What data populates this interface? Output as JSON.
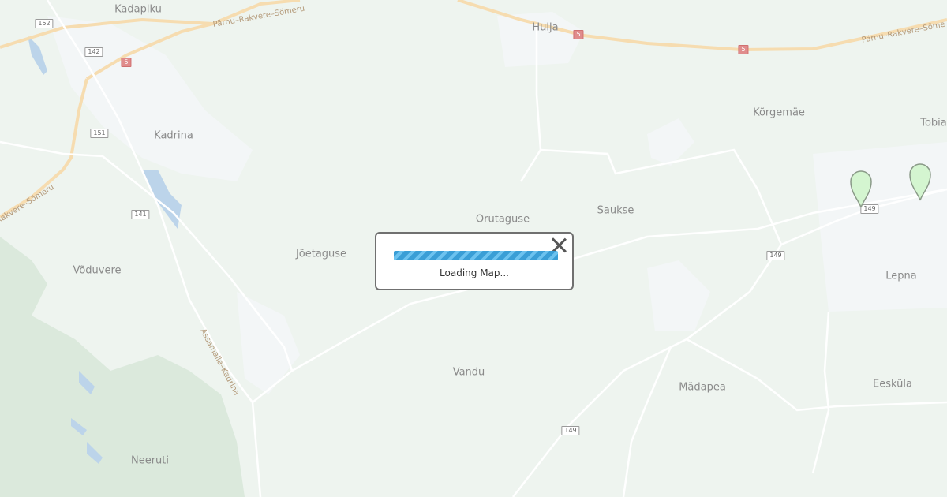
{
  "map": {
    "places": [
      {
        "name": "Kadapiku"
      },
      {
        "name": "Hulja"
      },
      {
        "name": "Kõrgemäe"
      },
      {
        "name": "Tobia"
      },
      {
        "name": "Kadrina"
      },
      {
        "name": "Orutaguse"
      },
      {
        "name": "Saukse"
      },
      {
        "name": "Jõetaguse"
      },
      {
        "name": "Võduvere"
      },
      {
        "name": "Lepna"
      },
      {
        "name": "Vandu"
      },
      {
        "name": "Mädapea"
      },
      {
        "name": "Eesküla"
      },
      {
        "name": "Neeruti"
      }
    ],
    "road_names": [
      "Pärnu–Rakvere–Sõmeru",
      "Pärnu–Rakvere–Sõme",
      "Pärnu–Rakvere–Sõmeru",
      "Rakvere–Sõmeru",
      "Assamalla–Kadrina"
    ],
    "road_shields": [
      "152",
      "142",
      "5",
      "151",
      "141",
      "5",
      "5",
      "149",
      "149",
      "149"
    ],
    "markers": [
      {
        "color": "#d4f5d0"
      },
      {
        "color": "#d4f5d0"
      }
    ]
  },
  "dialog": {
    "loading_text": "Loading Map...",
    "progress_color": "#3a9ed6"
  }
}
